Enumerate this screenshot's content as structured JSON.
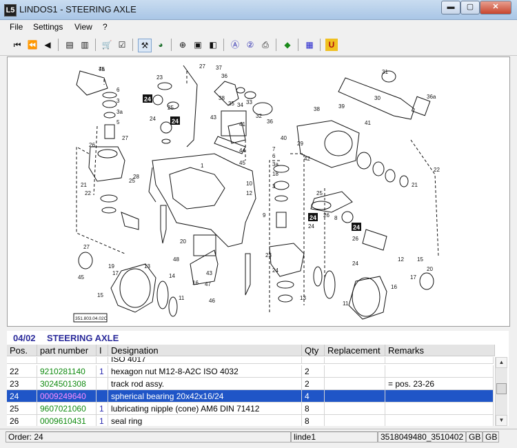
{
  "window": {
    "title": "LINDOS1 - STEERING AXLE",
    "app_icon": "L5",
    "minimize": "▬",
    "maximize": "▢",
    "close": "✕"
  },
  "menu": [
    "File",
    "Settings",
    "View",
    "?"
  ],
  "toolbar": {
    "icons": [
      "first-page-icon",
      "previous-section-icon",
      "previous-icon",
      "list-back-icon",
      "list-forward-icon",
      "cart-icon",
      "checklist-icon",
      "tools-icon",
      "globe-icon",
      "zoom-icon",
      "page-icon",
      "page-alt-icon",
      "at-icon",
      "help-icon",
      "print-icon",
      "export-icon",
      "grid-icon",
      "unit-icon"
    ]
  },
  "drawing": {
    "drawing_code": "351.803.04.02C",
    "callouts": [
      "7a",
      "6",
      "3",
      "3a",
      "5",
      "27",
      "26",
      "22",
      "21",
      "25",
      "24",
      "23",
      "25",
      "28",
      "27",
      "37",
      "38",
      "36",
      "35",
      "34",
      "33",
      "32",
      "36",
      "43",
      "41",
      "44",
      "45",
      "1",
      "40",
      "29",
      "42",
      "31",
      "30",
      "36a",
      "39",
      "38",
      "41",
      "22",
      "21",
      "24",
      "25",
      "26",
      "27",
      "20",
      "43",
      "47",
      "48",
      "46",
      "45",
      "19",
      "17",
      "15",
      "13",
      "11",
      "14",
      "16",
      "12",
      "10",
      "9",
      "24",
      "23",
      "18",
      "3",
      "3a",
      "6",
      "7",
      "8",
      "26",
      "24",
      "12",
      "17",
      "11",
      "15",
      "20",
      "16",
      "13",
      "45"
    ]
  },
  "section": {
    "number": "04/02",
    "title": "STEERING AXLE"
  },
  "table": {
    "headers": [
      "Pos.",
      "part number",
      "I",
      "Designation",
      "Qty",
      "Replacement",
      "Remarks"
    ],
    "rows": [
      {
        "pos": "",
        "part": "",
        "flag": "",
        "designation": "ISO 4017",
        "qty": "",
        "replacement": "",
        "remarks": ""
      },
      {
        "pos": "22",
        "part": "9210281140",
        "flag": "1",
        "designation": "hexagon nut M12-8-A2C  ISO 4032",
        "qty": "2",
        "replacement": "",
        "remarks": ""
      },
      {
        "pos": "23",
        "part": "3024501308",
        "flag": "",
        "designation": "track rod assy.",
        "qty": "2",
        "replacement": "",
        "remarks": "= pos. 23-26"
      },
      {
        "pos": "24",
        "part": "0009249640",
        "flag": "",
        "designation": "spherical bearing 20x42x16/24",
        "qty": "4",
        "replacement": "",
        "remarks": ""
      },
      {
        "pos": "25",
        "part": "9607021060",
        "flag": "1",
        "designation": "lubricating nipple (cone) AM6  DIN 71412",
        "qty": "8",
        "replacement": "",
        "remarks": ""
      },
      {
        "pos": "26",
        "part": "0009610431",
        "flag": "1",
        "designation": "seal ring",
        "qty": "8",
        "replacement": "",
        "remarks": ""
      }
    ],
    "selected_pos": "24"
  },
  "status": {
    "order": "Order: 24",
    "user": "linde1",
    "ident": "3518049480_3510402",
    "lang1": "GB",
    "lang2": "GB"
  },
  "colors": {
    "selection": "#1f55c7",
    "part_number": "#0f8a0f",
    "selected_part_number": "#ff8cff",
    "section_title": "#2a2a9a"
  }
}
